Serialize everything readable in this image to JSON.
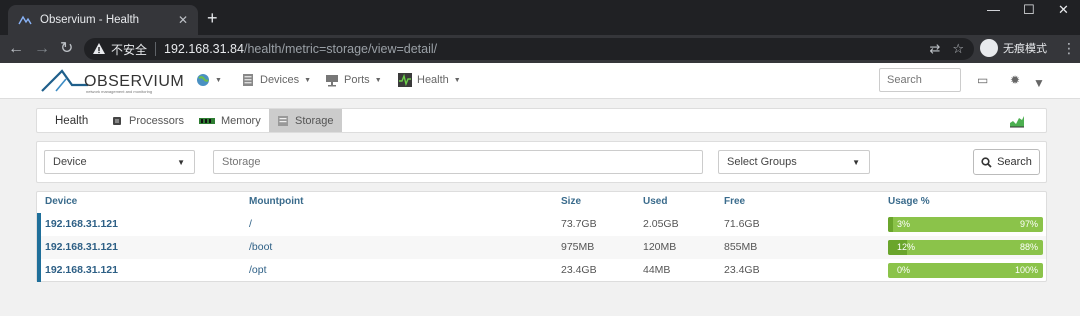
{
  "browser": {
    "tab_title": "Observium - Health",
    "new_tab": "+",
    "close": "✕",
    "min": "—",
    "max": "☐",
    "win_close": "✕",
    "insecure_label": "不安全",
    "url_host": "192.168.31.84",
    "url_path": "/health/metric=storage/view=detail/",
    "incognito_label": "无痕模式"
  },
  "nav": {
    "logo_text": "OBSERVIUM",
    "logo_sub": "network management and monitoring",
    "devices": "Devices",
    "ports": "Ports",
    "health": "Health",
    "search_placeholder": "Search"
  },
  "subtabs": {
    "title": "Health",
    "processors": "Processors",
    "memory": "Memory",
    "storage": "Storage"
  },
  "filters": {
    "device": "Device",
    "storage_placeholder": "Storage",
    "groups": "Select Groups",
    "search_button": "Search"
  },
  "table": {
    "headers": {
      "device": "Device",
      "mountpoint": "Mountpoint",
      "size": "Size",
      "used": "Used",
      "free": "Free",
      "usage": "Usage %"
    },
    "rows": [
      {
        "device": "192.168.31.121",
        "mountpoint": "/",
        "size": "73.7GB",
        "used": "2.05GB",
        "free": "71.6GB",
        "used_pct": "3%",
        "free_pct": "97%",
        "used_fraction": 0.03
      },
      {
        "device": "192.168.31.121",
        "mountpoint": "/boot",
        "size": "975MB",
        "used": "120MB",
        "free": "855MB",
        "used_pct": "12%",
        "free_pct": "88%",
        "used_fraction": 0.12
      },
      {
        "device": "192.168.31.121",
        "mountpoint": "/opt",
        "size": "23.4GB",
        "used": "44MB",
        "free": "23.4GB",
        "used_pct": "0%",
        "free_pct": "100%",
        "used_fraction": 0.0
      }
    ]
  },
  "colors": {
    "usage_free": "#8bc34a",
    "usage_used": "#6aa52c",
    "row_marker": "#1f6f9a",
    "link": "#2d5f85"
  }
}
